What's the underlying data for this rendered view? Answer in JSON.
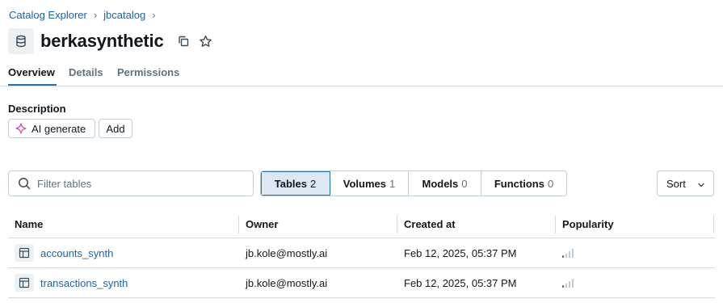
{
  "breadcrumb": {
    "items": [
      "Catalog Explorer",
      "jbcatalog"
    ],
    "separator": "›"
  },
  "header": {
    "title": "berkasynthetic",
    "icon": "database-icon"
  },
  "tabs": [
    {
      "label": "Overview",
      "active": true
    },
    {
      "label": "Details",
      "active": false
    },
    {
      "label": "Permissions",
      "active": false
    }
  ],
  "description": {
    "label": "Description",
    "ai_generate_label": "AI generate",
    "add_label": "Add"
  },
  "filter": {
    "placeholder": "Filter tables",
    "value": ""
  },
  "asset_tabs": [
    {
      "label": "Tables",
      "count": "2",
      "active": true
    },
    {
      "label": "Volumes",
      "count": "1",
      "active": false
    },
    {
      "label": "Models",
      "count": "0",
      "active": false
    },
    {
      "label": "Functions",
      "count": "0",
      "active": false
    }
  ],
  "sort": {
    "label": "Sort"
  },
  "table": {
    "columns": [
      "Name",
      "Owner",
      "Created at",
      "Popularity"
    ],
    "rows": [
      {
        "name": "accounts_synth",
        "owner": "jb.kole@mostly.ai",
        "created": "Feb 12, 2025, 05:37 PM",
        "popularity_bars": 1
      },
      {
        "name": "transactions_synth",
        "owner": "jb.kole@mostly.ai",
        "created": "Feb 12, 2025, 05:37 PM",
        "popularity_bars": 1
      }
    ]
  },
  "colors": {
    "link": "#1d63a8",
    "accent": "#2272b4",
    "active_segment_bg": "#dce7f2",
    "border": "#c0cdd8",
    "ai_gradient_start": "#b44ad4",
    "ai_gradient_end": "#e25a82"
  }
}
